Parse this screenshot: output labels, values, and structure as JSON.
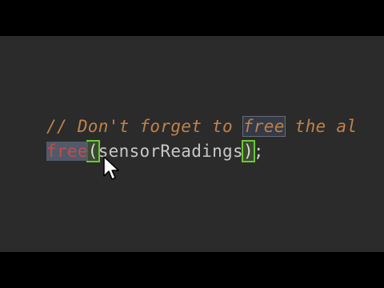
{
  "editor": {
    "comment_prefix": "// Don't forget to ",
    "comment_free_word": "free",
    "comment_suffix": " the al",
    "call_function": "free",
    "call_open_paren": "(",
    "call_argument": "sensorReadings",
    "call_close_paren": ")",
    "call_semicolon": ";"
  },
  "colors": {
    "background": "#2b2b2b",
    "comment": "#c0824a",
    "keyword_free": "#c24b4b",
    "identifier": "#c8c8c8",
    "bracket_match_outline": "#6bc832",
    "selection_highlight": "#515a6a"
  },
  "icons": {
    "mouse_pointer": "arrow-cursor-icon"
  }
}
